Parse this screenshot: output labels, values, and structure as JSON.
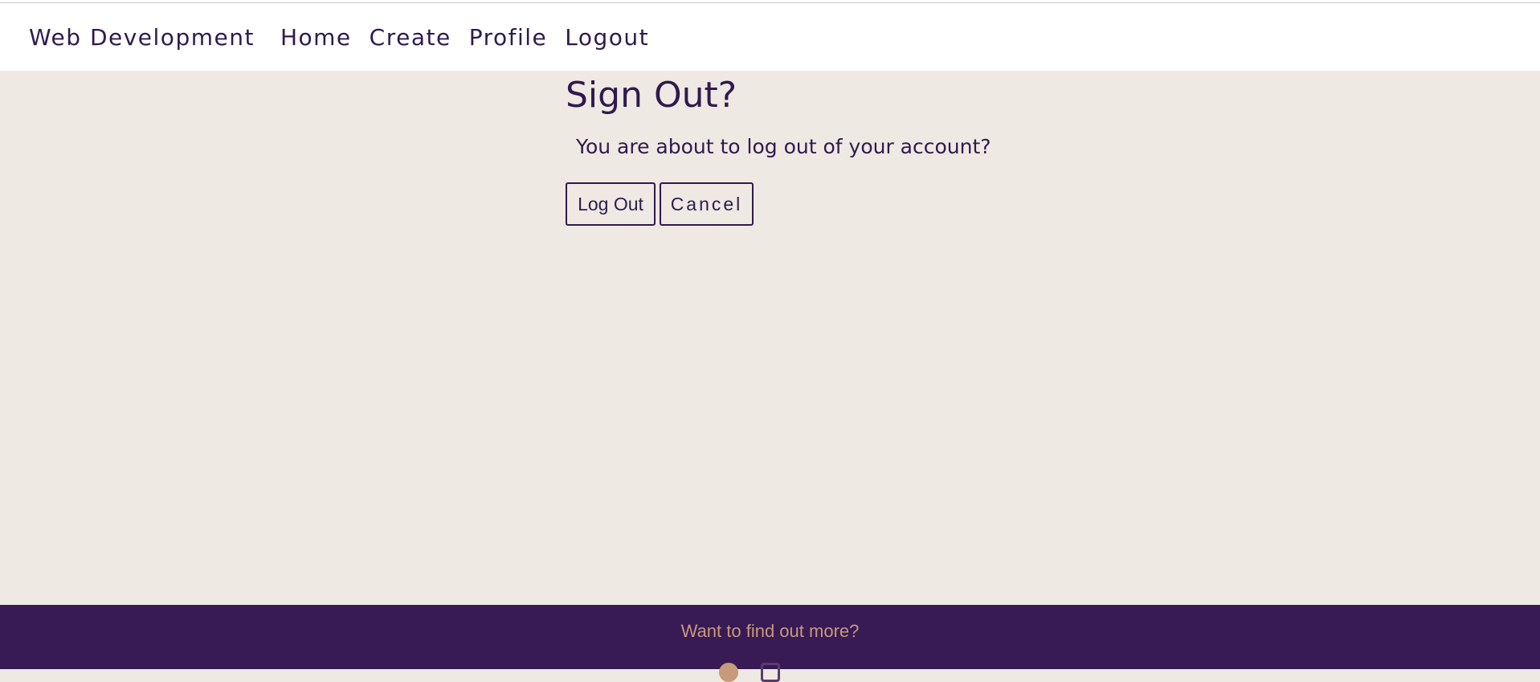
{
  "navbar": {
    "brand": "Web Development",
    "links": [
      "Home",
      "Create",
      "Profile",
      "Logout"
    ]
  },
  "main": {
    "title": "Sign Out?",
    "message": "You are about to log out of your account?",
    "logout_label": "Log Out",
    "cancel_label": "Cancel"
  },
  "footer": {
    "tagline": "Want to find out more?",
    "social_icons": [
      "facebook-icon",
      "instagram-icon",
      "twitter-icon"
    ]
  },
  "colors": {
    "brand_purple": "#2f1a4f",
    "footer_background": "#381a55",
    "footer_text": "#c79a7a",
    "page_background": "#eee9e2"
  }
}
